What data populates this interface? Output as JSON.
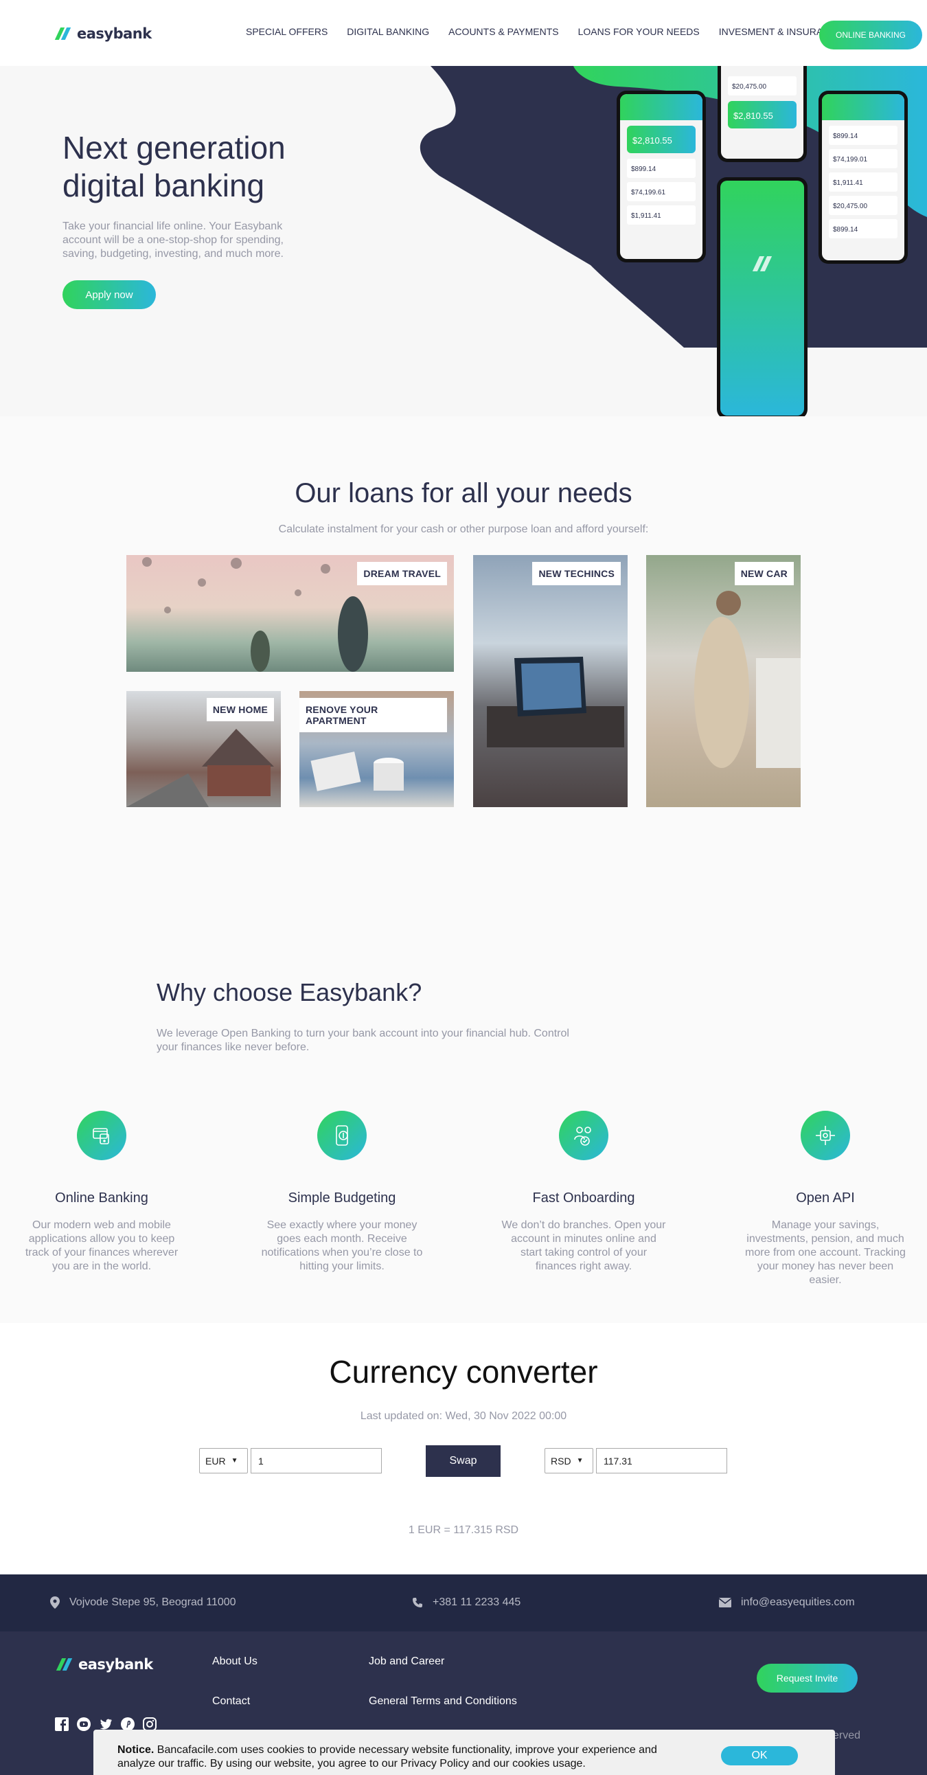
{
  "header": {
    "logo_text": "easybank",
    "nav": [
      "SPECIAL OFFERS",
      "DIGITAL BANKING",
      "ACOUNTS & PAYMENTS",
      "LOANS FOR YOUR NEEDS",
      "INVESMENT & INSURANCE"
    ],
    "cta": "ONLINE BANKING"
  },
  "hero": {
    "title": "Next generation digital banking",
    "text": "Take your financial life online. Your Easybank account will be a one-stop-shop for spending, saving, budgeting, investing, and much more.",
    "cta": "Apply now",
    "phone_values": [
      "$2,810.55",
      "$899.14",
      "$74,199.61",
      "$1,911.41",
      "$20,475.00",
      "$1,911.41",
      "$2,810.55",
      "$899.14",
      "$74,199.01",
      "$1,911.41",
      "$20,475.00",
      "$899.14"
    ]
  },
  "loans": {
    "title": "Our loans for all your needs",
    "subtitle": "Calculate instalment for your cash or other purpose loan and afford yourself:",
    "tiles": [
      "DREAM TRAVEL",
      "NEW TECHINCS",
      "NEW CAR",
      "NEW HOME",
      "RENOVE YOUR APARTMENT"
    ]
  },
  "why": {
    "title": "Why choose Easybank?",
    "text": "We leverage Open Banking to turn your bank account into your financial hub. Control your finances like never before.",
    "features": [
      {
        "title": "Online Banking",
        "text": "Our modern web and mobile applications allow you to keep track of your finances wherever you are in the world.",
        "icon": "online-banking-icon"
      },
      {
        "title": "Simple Budgeting",
        "text": "See exactly where your money goes each month. Receive notifications when you’re close to hitting your limits.",
        "icon": "budgeting-icon"
      },
      {
        "title": "Fast Onboarding",
        "text": "We don’t do branches. Open your account in minutes online and start taking control of your finances right away.",
        "icon": "onboarding-icon"
      },
      {
        "title": "Open API",
        "text": "Manage your savings, investments, pension, and much more from one account. Tracking your money has never been easier.",
        "icon": "api-icon"
      }
    ]
  },
  "converter": {
    "title": "Currency converter",
    "updated": "Last updated on: Wed, 30 Nov 2022 00:00",
    "from_currency": "EUR",
    "from_amount": "1",
    "swap": "Swap",
    "to_currency": "RSD",
    "to_amount": "117.31",
    "rate": "1 EUR = 117.315 RSD"
  },
  "contact": {
    "address": "Vojvode Stepe 95, Beograd 11000",
    "phone": "+381 11 2233 445",
    "email": "info@easyequities.com"
  },
  "footer": {
    "logo_text": "easybank",
    "links": [
      "About Us",
      "Job and Career",
      "Contact",
      "General Terms and Conditions"
    ],
    "cta": "Request Invite",
    "rights": "© Easybank. All Rights Reserved",
    "socials": [
      "facebook-icon",
      "youtube-icon",
      "twitter-icon",
      "pinterest-icon",
      "instagram-icon"
    ]
  },
  "cookie": {
    "label": "Notice.",
    "text": "Bancafacile.com uses cookies to provide necessary website functionality, improve your experience and analyze our traffic. By using our website, you agree to our Privacy Policy and our cookies usage.",
    "ok": "OK"
  },
  "colors": {
    "primary": "#2d314d",
    "accent_green": "#31d35c",
    "accent_cyan": "#2bb7da",
    "muted": "#9698a6"
  }
}
